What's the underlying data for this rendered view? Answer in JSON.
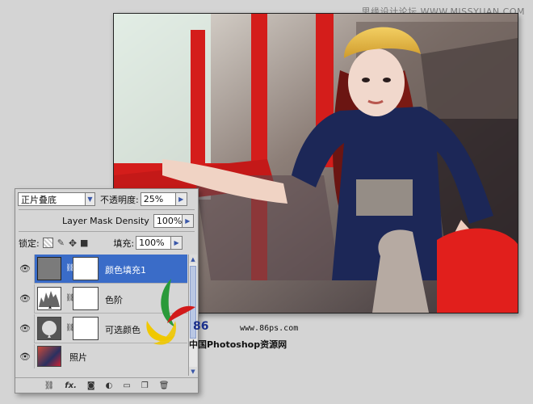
{
  "watermark_top": "思缘设计论坛 WWW.MISSYUAN.COM",
  "panel": {
    "blend_mode": "正片叠底",
    "opacity_label": "不透明度:",
    "opacity_value": "25%",
    "mask_density_label": "Layer Mask Density",
    "mask_density_value": "100%",
    "lock_label": "锁定:",
    "fill_label": "填充:",
    "fill_value": "100%",
    "layers": [
      {
        "name": "颜色填充1",
        "selected": true
      },
      {
        "name": "色阶",
        "selected": false
      },
      {
        "name": "可选颜色",
        "selected": false
      },
      {
        "name": "照片",
        "selected": false
      }
    ],
    "bottom_icons": [
      "link-icon",
      "fx-icon",
      "mask-icon",
      "adjustment-icon",
      "group-icon",
      "new-layer-icon",
      "trash-icon"
    ],
    "fx_text": "fx."
  },
  "site": {
    "num": "86",
    "url": "www.86ps.com",
    "name": "中国Photoshop资源网"
  },
  "colors": {
    "selection": "#3a6cc8",
    "accent_red": "#e0201c",
    "logo_green": "#2a9a3a",
    "logo_yellow": "#f0c800",
    "logo_red": "#d21a1a"
  }
}
